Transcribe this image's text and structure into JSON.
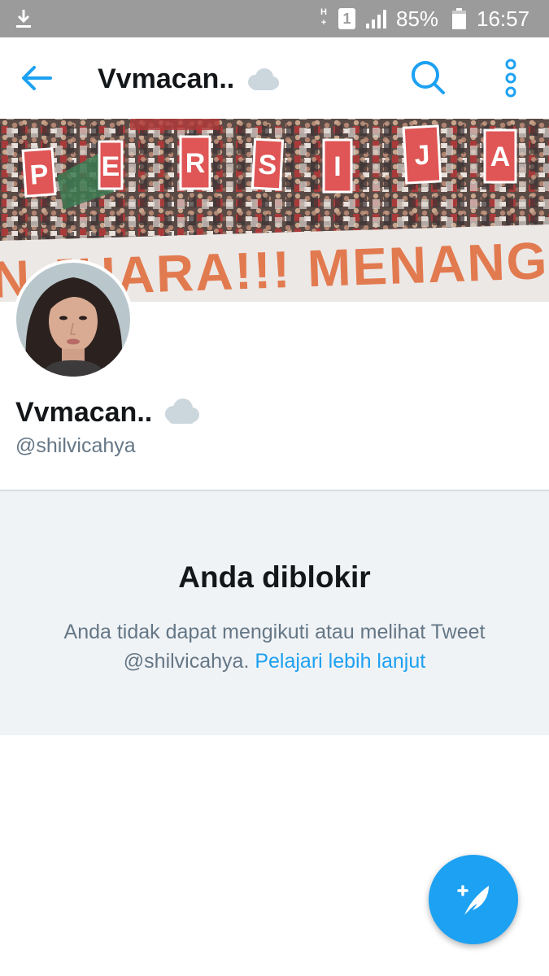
{
  "status_bar": {
    "network_type_top": "H",
    "network_type_bottom": "+",
    "sim_slot": "1",
    "battery_percent": "85%",
    "time": "16:57"
  },
  "header": {
    "title": "Vvmacan..",
    "icons": [
      "back-arrow-icon",
      "cloud-icon",
      "search-icon",
      "more-vertical-icon"
    ]
  },
  "banner": {
    "sign_letters": [
      "P",
      "E",
      "R",
      "S",
      "I",
      "J",
      "A"
    ],
    "banner_text": "N JUARA!!! MENANG A"
  },
  "profile": {
    "display_name": "Vvmacan..",
    "username": "@shilvicahya"
  },
  "blocked": {
    "title": "Anda diblokir",
    "message_line1": "Anda tidak dapat mengikuti atau melihat Tweet",
    "message_line2": "@shilvicahya.",
    "learn_more": "Pelajari lebih lanjut"
  },
  "fab": {
    "icon": "compose-tweet-icon"
  },
  "colors": {
    "accent": "#1da1f2",
    "status_bar": "#9b9b9b",
    "panel_background": "#f0f3f6",
    "secondary_text": "#657786",
    "primary_text": "#14171a"
  }
}
